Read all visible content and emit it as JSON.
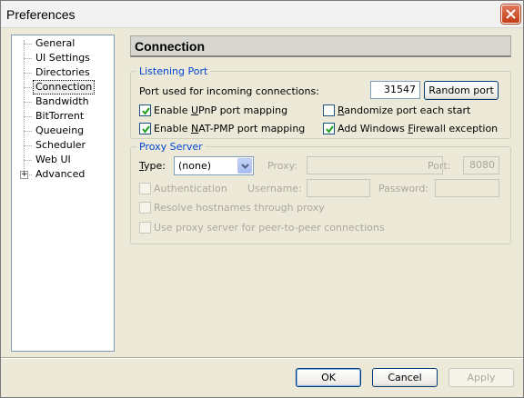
{
  "window": {
    "title": "Preferences"
  },
  "sidebar": {
    "items": [
      {
        "label": "General"
      },
      {
        "label": "UI Settings"
      },
      {
        "label": "Directories"
      },
      {
        "label": "Connection",
        "selected": true
      },
      {
        "label": "Bandwidth"
      },
      {
        "label": "BitTorrent"
      },
      {
        "label": "Queueing"
      },
      {
        "label": "Scheduler"
      },
      {
        "label": "Web UI"
      },
      {
        "label": "Advanced",
        "expandable": true,
        "expander": "+"
      }
    ]
  },
  "page": {
    "title": "Connection"
  },
  "listening_port": {
    "legend": "Listening Port",
    "port_label": "Port used for incoming connections:",
    "port_value": "31547",
    "random_port_button": "Random port",
    "upnp": {
      "pre": "Enable ",
      "key": "U",
      "post": "PnP port mapping",
      "checked": true
    },
    "randomize": {
      "pre": "",
      "key": "R",
      "post": "andomize port each start",
      "checked": false
    },
    "natpmp": {
      "pre": "Enable ",
      "key": "N",
      "post": "AT-PMP port mapping",
      "checked": true
    },
    "firewall": {
      "pre": "Add Windows ",
      "key": "F",
      "post": "irewall exception",
      "checked": true
    }
  },
  "proxy_server": {
    "legend": "Proxy Server",
    "type_label_key": "T",
    "type_label_rest": "ype:",
    "type_value": "(none)",
    "proxy_label": "Proxy:",
    "port_label": "Port:",
    "port_value": "8080",
    "authentication_label": "Authentication",
    "username_label": "Username:",
    "password_label": "Password:",
    "resolve_label": "Resolve hostnames through proxy",
    "p2p_label": "Use proxy server for peer-to-peer connections"
  },
  "footer": {
    "ok": "OK",
    "cancel": "Cancel",
    "apply": "Apply"
  },
  "colors": {
    "legend": "#0046d5",
    "disabled_text": "#aca899",
    "window_bg": "#ece9d8"
  }
}
